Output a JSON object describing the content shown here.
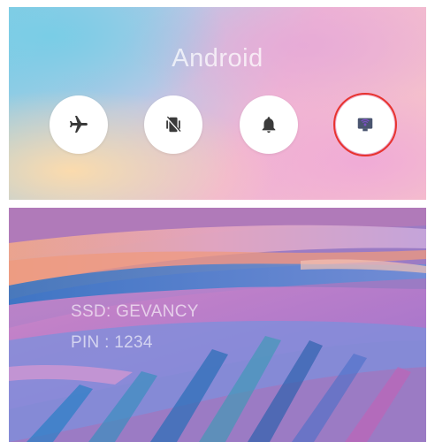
{
  "top_panel": {
    "title": "Android",
    "quick_settings": [
      {
        "name": "airplane-mode",
        "icon": "airplane-icon"
      },
      {
        "name": "vibrate",
        "icon": "vibrate-icon"
      },
      {
        "name": "notifications",
        "icon": "bell-icon"
      },
      {
        "name": "hotspot",
        "icon": "hotspot-icon",
        "highlighted": true
      }
    ],
    "highlight_color": "#e8332f"
  },
  "bottom_panel": {
    "ssid_text": "SSD: GEVANCY",
    "pin_text": "PIN : 1234"
  }
}
